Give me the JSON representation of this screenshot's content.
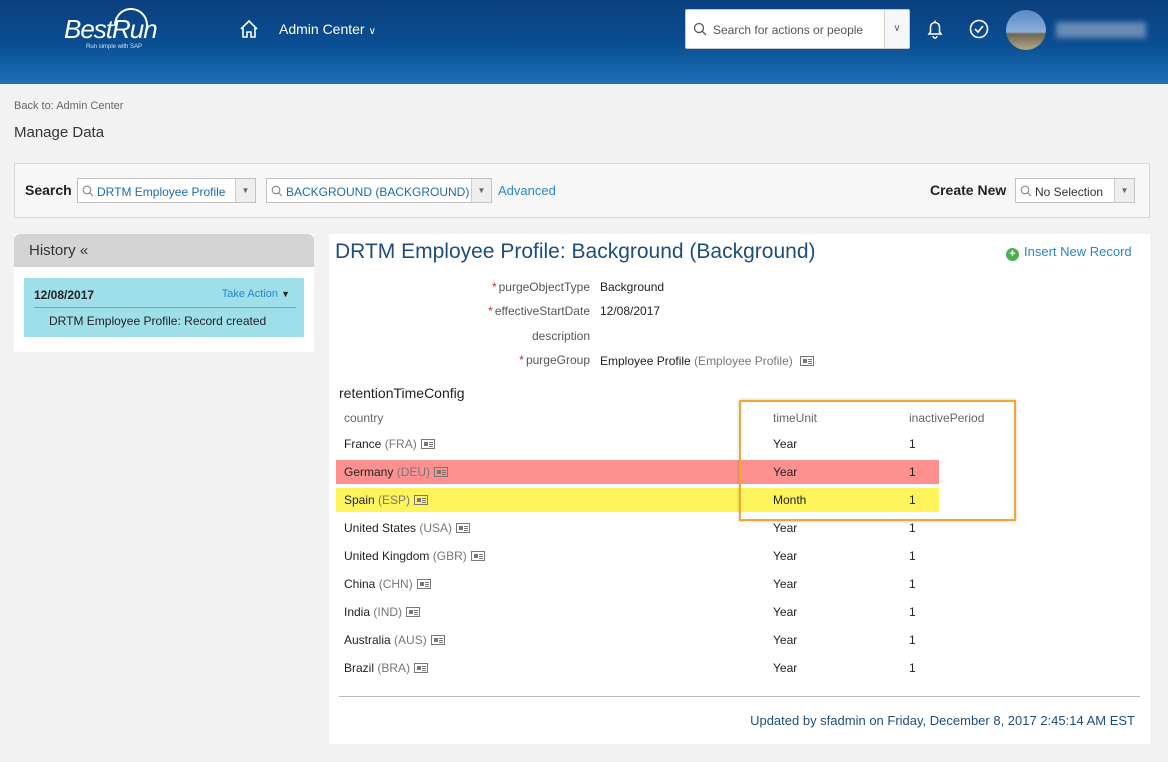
{
  "header": {
    "logo_text": "BestRun",
    "logo_tagline": "Run simple with SAP",
    "admin_center": "Admin Center",
    "search_placeholder": "Search for actions or people"
  },
  "breadcrumb": {
    "back": "Back to: Admin Center"
  },
  "page_title": "Manage Data",
  "search": {
    "label": "Search",
    "object_type": "DRTM Employee Profile",
    "object": "BACKGROUND (BACKGROUND)",
    "advanced": "Advanced",
    "create_new_label": "Create New",
    "create_new_value": "No Selection"
  },
  "history": {
    "title": "History «",
    "entry": {
      "date": "12/08/2017",
      "action": "Take Action",
      "description": "DRTM Employee Profile: Record created"
    }
  },
  "record": {
    "title": "DRTM Employee Profile: Background (Background)",
    "insert_new": "Insert New Record",
    "fields": {
      "purge_object_type": {
        "label": "purgeObjectType",
        "value": "Background"
      },
      "effective_start_date": {
        "label": "effectiveStartDate",
        "value": "12/08/2017"
      },
      "description": {
        "label": "description",
        "value": ""
      },
      "purge_group": {
        "label": "purgeGroup",
        "value": "Employee Profile",
        "sub": "(Employee Profile)"
      }
    },
    "retention": {
      "title": "retentionTimeConfig",
      "columns": {
        "country": "country",
        "time_unit": "timeUnit",
        "inactive_period": "inactivePeriod"
      },
      "rows": [
        {
          "country": "France",
          "code": "(FRA)",
          "unit": "Year",
          "period": "1"
        },
        {
          "country": "Germany",
          "code": "(DEU)",
          "unit": "Year",
          "period": "1"
        },
        {
          "country": "Spain",
          "code": "(ESP)",
          "unit": "Month",
          "period": "1"
        },
        {
          "country": "United States",
          "code": "(USA)",
          "unit": "Year",
          "period": "1"
        },
        {
          "country": "United Kingdom",
          "code": "(GBR)",
          "unit": "Year",
          "period": "1"
        },
        {
          "country": "China",
          "code": "(CHN)",
          "unit": "Year",
          "period": "1"
        },
        {
          "country": "India",
          "code": "(IND)",
          "unit": "Year",
          "period": "1"
        },
        {
          "country": "Australia",
          "code": "(AUS)",
          "unit": "Year",
          "period": "1"
        },
        {
          "country": "Brazil",
          "code": "(BRA)",
          "unit": "Year",
          "period": "1"
        }
      ]
    },
    "updated": "Updated by sfadmin on Friday, December 8, 2017 2:45:14 AM EST"
  }
}
